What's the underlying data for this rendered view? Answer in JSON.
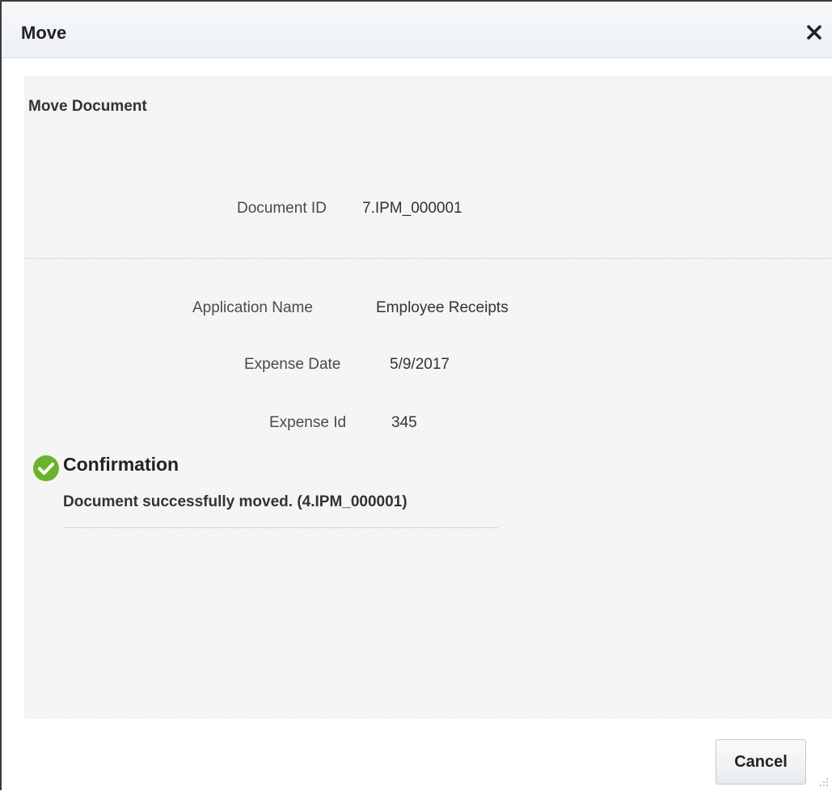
{
  "dialog": {
    "title": "Move",
    "close_icon": "close-icon"
  },
  "section": {
    "title": "Move Document"
  },
  "fields": {
    "document_id": {
      "label": "Document ID",
      "value": "7.IPM_000001"
    },
    "application_name": {
      "label": "Application Name",
      "value": "Employee Receipts"
    },
    "expense_date": {
      "label": "Expense Date",
      "value": "5/9/2017"
    },
    "expense_id": {
      "label": "Expense Id",
      "value": "345"
    }
  },
  "confirmation": {
    "icon": "check-circle-icon",
    "title": "Confirmation",
    "message": "Document successfully moved. (4.IPM_000001)"
  },
  "footer": {
    "cancel_label": "Cancel"
  },
  "colors": {
    "success": "#6ab42d",
    "title_text": "#222222"
  }
}
